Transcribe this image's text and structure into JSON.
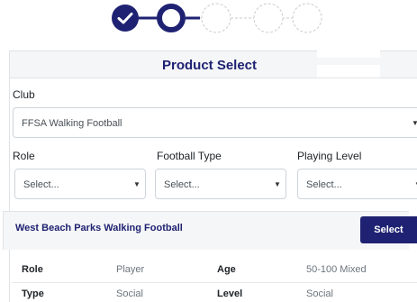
{
  "stepper": {
    "steps": [
      {
        "state": "complete",
        "icon": "check-icon"
      },
      {
        "state": "current"
      },
      {
        "state": "pending"
      },
      {
        "state": "pending"
      },
      {
        "state": "pending"
      }
    ],
    "colors": {
      "primary": "#1f2272",
      "pending": "#c9cdd2"
    }
  },
  "panel": {
    "title": "Product Select"
  },
  "club": {
    "label": "Club",
    "value": "FFSA Walking Football"
  },
  "filters": [
    {
      "label": "Role",
      "value": "Select..."
    },
    {
      "label": "Football Type",
      "value": "Select..."
    },
    {
      "label": "Playing Level",
      "value": "Select..."
    }
  ],
  "result": {
    "title": "West Beach Parks Walking Football",
    "button_label": "Select",
    "details": {
      "role_label": "Role",
      "role_value": "Player",
      "age_label": "Age",
      "age_value": "50-100 Mixed",
      "type_label": "Type",
      "type_value": "Social",
      "level_label": "Level",
      "level_value": "Social"
    }
  },
  "theme": {
    "accent": "#1f2272",
    "border": "#ced4da"
  }
}
